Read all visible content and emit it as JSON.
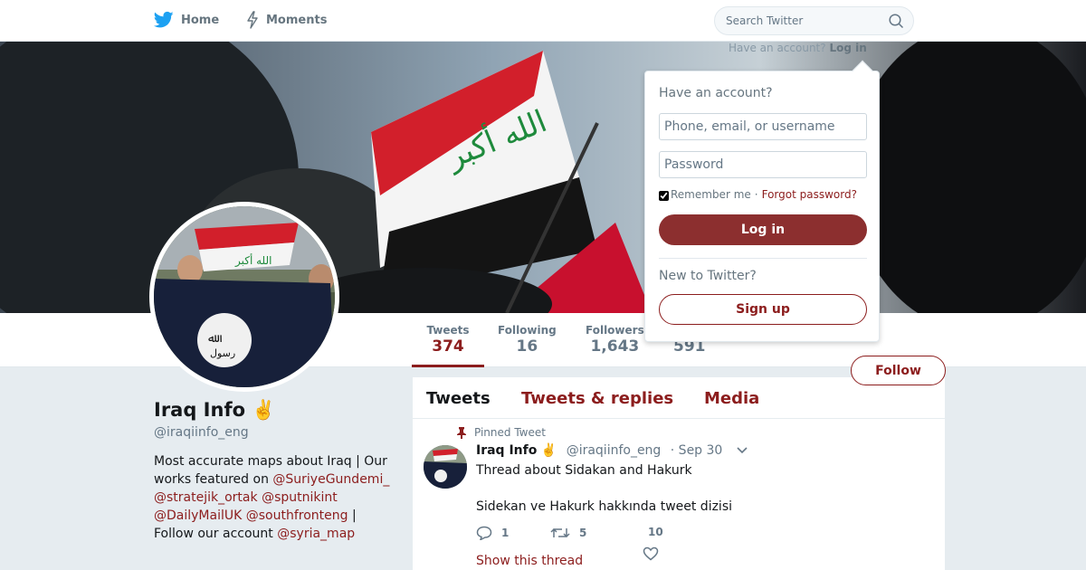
{
  "colors": {
    "accent": "#8c1d1d",
    "login_button": "#8c2f2f",
    "background": "#e6ecf0",
    "flag_red": "#ce1126",
    "flag_green": "#007a3d"
  },
  "topnav": {
    "home_label": "Home",
    "home_icon": "twitter-bird-icon",
    "moments_label": "Moments",
    "moments_icon": "lightning-icon",
    "search_placeholder": "Search Twitter",
    "search_icon": "search-icon"
  },
  "login_hint": {
    "text": "Have an account?",
    "link": "Log in"
  },
  "login_dropdown": {
    "title": "Have an account?",
    "username_placeholder": "Phone, email, or username",
    "password_placeholder": "Password",
    "remember_label": "Remember me",
    "separator": "·",
    "forgot_label": "Forgot password?",
    "login_label": "Log in",
    "new_label": "New to Twitter?",
    "signup_label": "Sign up"
  },
  "stats": {
    "tweets_label": "Tweets",
    "tweets_value": "374",
    "following_label": "Following",
    "following_value": "16",
    "followers_label": "Followers",
    "followers_value": "1,643",
    "likes_value": "591"
  },
  "follow_label": "Follow",
  "profile": {
    "name": "Iraq Info",
    "emoji": "✌️",
    "handle": "@iraqiinfo_eng",
    "bio_1": "Most accurate maps about Iraq | Our works featured on",
    "bio_m1": "@SuriyeGundemi_",
    "bio_m2": "@stratejik_ortak",
    "bio_m3": "@sputnikint",
    "bio_m4": "@DailyMailUK",
    "bio_m5": "@southfronteng",
    "bio_2": "| Follow our account",
    "bio_m6": "@syria_map"
  },
  "timeline": {
    "tabs": [
      "Tweets",
      "Tweets & replies",
      "Media"
    ],
    "active_tab": "Tweets"
  },
  "tweet": {
    "pinned_label": "Pinned Tweet",
    "name": "Iraq Info",
    "emoji": "✌️",
    "handle": "@iraqiinfo_eng",
    "date": "· Sep 30",
    "text_1": "Thread about Sidakan and Hakurk",
    "text_2": "Sidekan ve Hakurk hakkında tweet dizisi",
    "replies": "1",
    "retweets": "5",
    "likes": "10",
    "show_thread": "Show this thread"
  }
}
